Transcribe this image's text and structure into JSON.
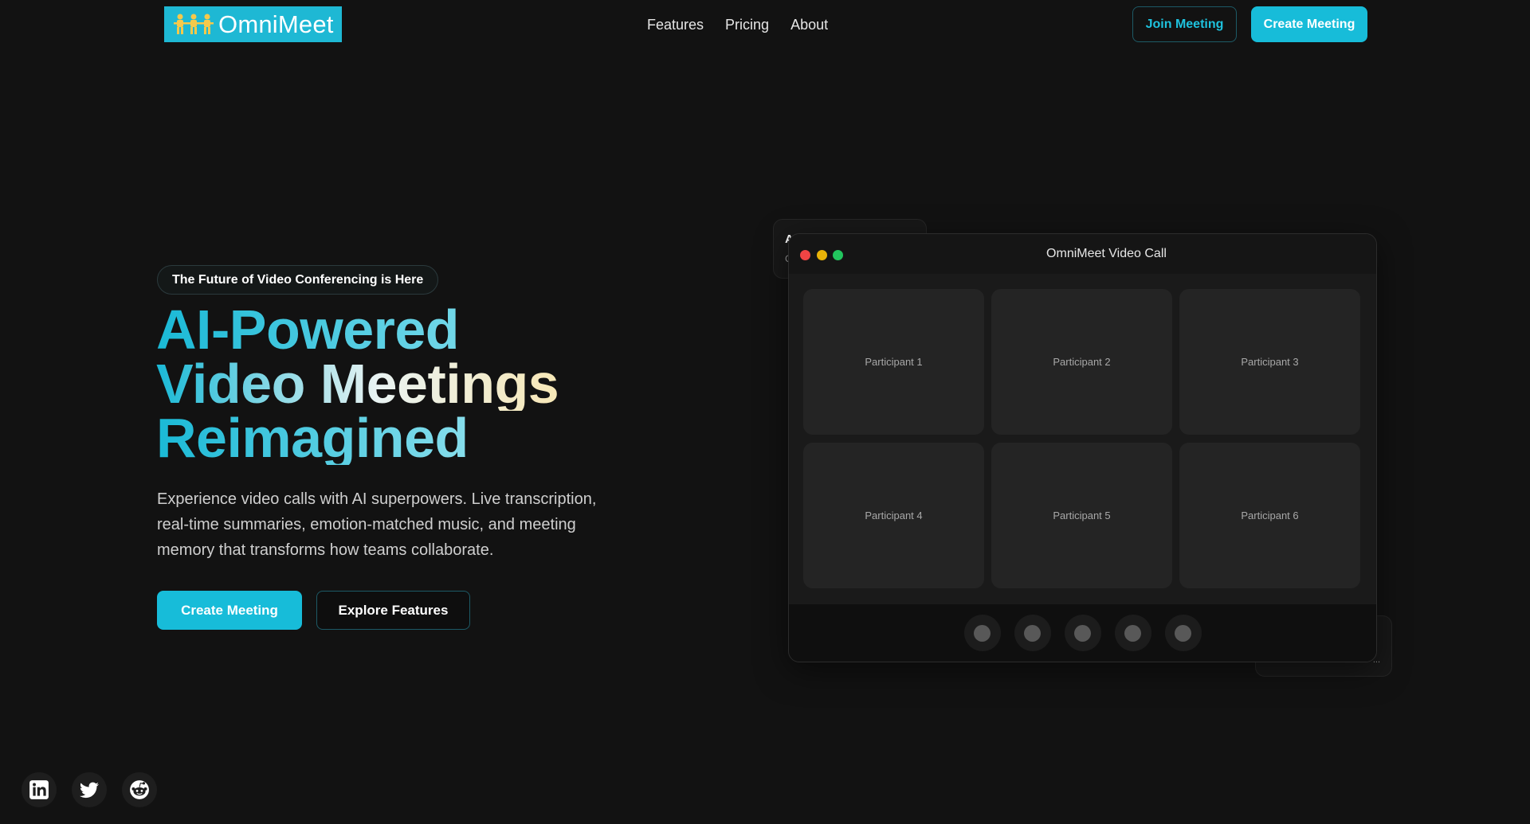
{
  "nav": {
    "logo_text": "OmniMeet",
    "links": [
      "Features",
      "Pricing",
      "About"
    ],
    "join_label": "Join Meeting",
    "create_label": "Create Meeting"
  },
  "hero": {
    "badge": "The Future of Video Conferencing is Here",
    "headline": [
      "AI-Powered",
      "Video Meetings",
      "Reimagined"
    ],
    "description": "Experience video calls with AI superpowers. Live transcription, real-time summaries, emotion-matched music, and meeting memory that transforms how teams collaborate.",
    "cta_primary": "Create Meeting",
    "cta_secondary": "Explore Features"
  },
  "video_window": {
    "title": "OmniMeet Video Call",
    "participants": [
      "Participant 1",
      "Participant 2",
      "Participant 3",
      "Participant 4",
      "Participant 5",
      "Participant 6"
    ],
    "control_count": 5
  },
  "float_cards": {
    "back_letter": "A",
    "back_letter2": "C",
    "front_text": "..."
  },
  "social": [
    "linkedin-icon",
    "twitter-icon",
    "reddit-icon"
  ],
  "colors": {
    "accent": "#17bcd9",
    "background": "#121212",
    "window_dot_red": "#ef4444",
    "window_dot_yellow": "#eab308",
    "window_dot_green": "#22c55e"
  }
}
